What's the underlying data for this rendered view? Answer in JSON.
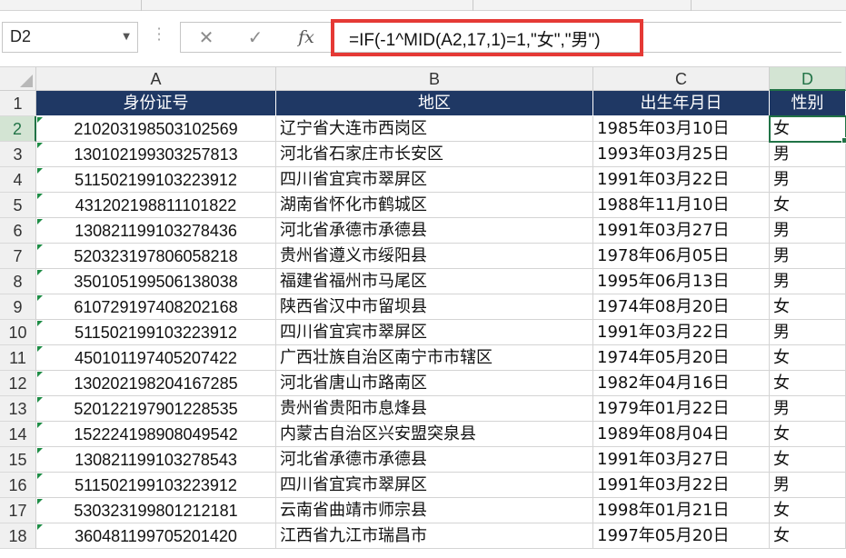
{
  "name_box": {
    "value": "D2"
  },
  "formula_bar": {
    "cancel_icon": "close-icon",
    "confirm_icon": "check-icon",
    "fx_label": "fx",
    "formula": "=IF(-1^MID(A2,17,1)=1,\"女\",\"男\")"
  },
  "highlight_color": "#e53935",
  "header_fill": "#1f3864",
  "selection_color": "#217346",
  "columns": [
    "A",
    "B",
    "C",
    "D"
  ],
  "table": {
    "headers": [
      "身份证号",
      "地区",
      "出生年月日",
      "性别"
    ],
    "rows": [
      [
        "210203198503102569",
        "辽宁省大连市西岗区",
        "1985年03月10日",
        "女"
      ],
      [
        "130102199303257813",
        "河北省石家庄市长安区",
        "1993年03月25日",
        "男"
      ],
      [
        "511502199103223912",
        "四川省宜宾市翠屏区",
        "1991年03月22日",
        "男"
      ],
      [
        "431202198811101822",
        "湖南省怀化市鹤城区",
        "1988年11月10日",
        "女"
      ],
      [
        "130821199103278436",
        "河北省承德市承德县",
        "1991年03月27日",
        "男"
      ],
      [
        "520323197806058218",
        "贵州省遵义市绥阳县",
        "1978年06月05日",
        "男"
      ],
      [
        "350105199506138038",
        "福建省福州市马尾区",
        "1995年06月13日",
        "男"
      ],
      [
        "610729197408202168",
        "陕西省汉中市留坝县",
        "1974年08月20日",
        "女"
      ],
      [
        "511502199103223912",
        "四川省宜宾市翠屏区",
        "1991年03月22日",
        "男"
      ],
      [
        "450101197405207422",
        "广西壮族自治区南宁市市辖区",
        "1974年05月20日",
        "女"
      ],
      [
        "130202198204167285",
        "河北省唐山市路南区",
        "1982年04月16日",
        "女"
      ],
      [
        "520122197901228535",
        "贵州省贵阳市息烽县",
        "1979年01月22日",
        "男"
      ],
      [
        "152224198908049542",
        "内蒙古自治区兴安盟突泉县",
        "1989年08月04日",
        "女"
      ],
      [
        "130821199103278543",
        "河北省承德市承德县",
        "1991年03月27日",
        "女"
      ],
      [
        "511502199103223912",
        "四川省宜宾市翠屏区",
        "1991年03月22日",
        "男"
      ],
      [
        "530323199801212181",
        "云南省曲靖市师宗县",
        "1998年01月21日",
        "女"
      ],
      [
        "360481199705201420",
        "江西省九江市瑞昌市",
        "1997年05月20日",
        "女"
      ]
    ]
  }
}
